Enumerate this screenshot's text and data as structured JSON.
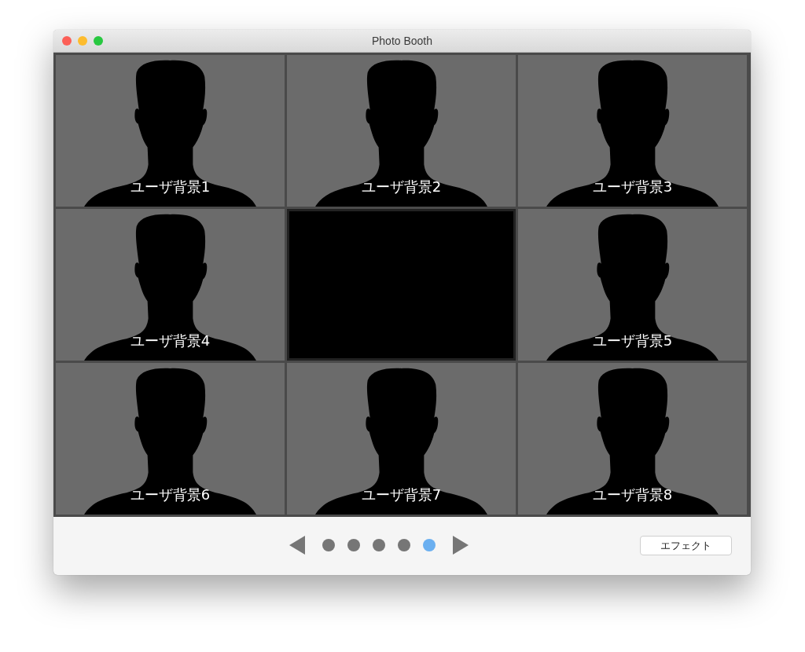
{
  "window": {
    "title": "Photo Booth"
  },
  "tiles": [
    {
      "kind": "silhouette",
      "label": "ユーザ背景1"
    },
    {
      "kind": "silhouette",
      "label": "ユーザ背景2"
    },
    {
      "kind": "silhouette",
      "label": "ユーザ背景3"
    },
    {
      "kind": "silhouette",
      "label": "ユーザ背景4"
    },
    {
      "kind": "blank"
    },
    {
      "kind": "silhouette",
      "label": "ユーザ背景5"
    },
    {
      "kind": "silhouette",
      "label": "ユーザ背景6"
    },
    {
      "kind": "silhouette",
      "label": "ユーザ背景7"
    },
    {
      "kind": "silhouette",
      "label": "ユーザ背景8"
    }
  ],
  "pages": [
    {
      "selected": false
    },
    {
      "selected": false
    },
    {
      "selected": false
    },
    {
      "selected": false
    },
    {
      "selected": true
    }
  ],
  "effects_button": "エフェクト"
}
